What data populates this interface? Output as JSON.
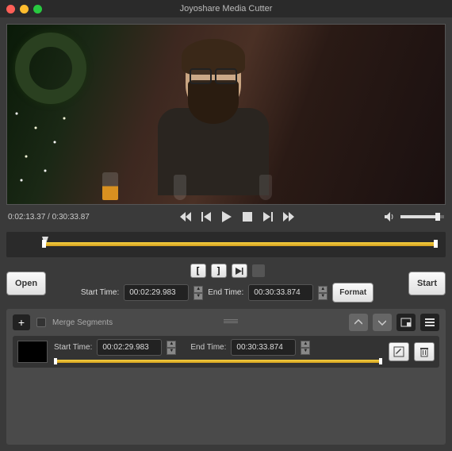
{
  "window": {
    "title": "Joyoshare Media Cutter"
  },
  "playback": {
    "current_time": "0:02:13.37",
    "total_time": "0:30:33.87",
    "time_display": "0:02:13.37 / 0:30:33.87"
  },
  "buttons": {
    "open": "Open",
    "format": "Format",
    "start": "Start"
  },
  "trim": {
    "start_label": "Start Time:",
    "start_value": "00:02:29.983",
    "end_label": "End Time:",
    "end_value": "00:30:33.874"
  },
  "segments": {
    "merge_label": "Merge Segments",
    "items": [
      {
        "start_label": "Start Time:",
        "start_value": "00:02:29.983",
        "end_label": "End Time:",
        "end_value": "00:30:33.874"
      }
    ]
  }
}
